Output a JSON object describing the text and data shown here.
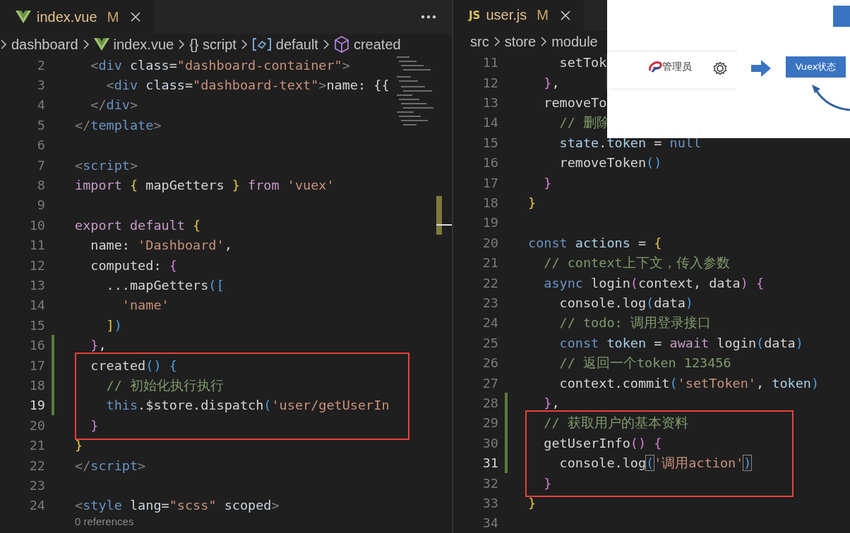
{
  "editors": [
    {
      "tab": {
        "name": "index.vue",
        "status": "M",
        "selected": true
      },
      "breadcrumbs": [
        {
          "label": "dashboard",
          "kind": "folder"
        },
        {
          "label": "index.vue",
          "kind": "file"
        },
        {
          "label": "{} script",
          "kind": "block"
        },
        {
          "label": "default",
          "kind": "namespace"
        },
        {
          "label": "created",
          "kind": "method"
        }
      ],
      "lines": [
        {
          "number": "2",
          "current": false,
          "changed": false,
          "highlighted": false,
          "tokens": [
            {
              "kind": "p",
              "text": "  <"
            },
            {
              "kind": "tag",
              "text": "div"
            },
            {
              "kind": "at",
              "text": " class"
            },
            {
              "kind": "t",
              "text": "="
            },
            {
              "kind": "s",
              "text": "\"dashboard-container\""
            },
            {
              "kind": "p",
              "text": ">"
            }
          ]
        },
        {
          "number": "3",
          "current": false,
          "changed": false,
          "highlighted": false,
          "tokens": [
            {
              "kind": "p",
              "text": "    <"
            },
            {
              "kind": "tag",
              "text": "div"
            },
            {
              "kind": "at",
              "text": " class"
            },
            {
              "kind": "t",
              "text": "="
            },
            {
              "kind": "s",
              "text": "\"dashboard-text\""
            },
            {
              "kind": "p",
              "text": ">"
            },
            {
              "kind": "t",
              "text": "name: {{"
            }
          ]
        },
        {
          "number": "4",
          "current": false,
          "changed": false,
          "highlighted": false,
          "tokens": [
            {
              "kind": "p",
              "text": "  </"
            },
            {
              "kind": "tag",
              "text": "div"
            },
            {
              "kind": "p",
              "text": ">"
            }
          ]
        },
        {
          "number": "5",
          "current": false,
          "changed": false,
          "highlighted": false,
          "tokens": [
            {
              "kind": "p",
              "text": "</"
            },
            {
              "kind": "tag",
              "text": "template"
            },
            {
              "kind": "p",
              "text": ">"
            }
          ]
        },
        {
          "number": "6",
          "current": false,
          "changed": false,
          "highlighted": false
        },
        {
          "number": "7",
          "current": false,
          "changed": false,
          "highlighted": false,
          "tokens": [
            {
              "kind": "p",
              "text": "<"
            },
            {
              "kind": "tag",
              "text": "script"
            },
            {
              "kind": "p",
              "text": ">"
            }
          ]
        },
        {
          "number": "8",
          "current": false,
          "changed": false,
          "highlighted": false,
          "tokens": [
            {
              "kind": "kw",
              "text": "import"
            },
            {
              "kind": "y",
              "text": " {"
            },
            {
              "kind": "t",
              "text": " mapGetters "
            },
            {
              "kind": "y",
              "text": "}"
            },
            {
              "kind": "kw",
              "text": " from"
            },
            {
              "kind": "s",
              "text": " 'vuex'"
            }
          ]
        },
        {
          "number": "9",
          "current": false,
          "changed": false,
          "highlighted": false
        },
        {
          "number": "10",
          "current": false,
          "changed": false,
          "highlighted": false,
          "tokens": [
            {
              "kind": "kw",
              "text": "export default"
            },
            {
              "kind": "y",
              "text": " {"
            }
          ]
        },
        {
          "number": "11",
          "current": false,
          "changed": false,
          "highlighted": false,
          "tokens": [
            {
              "kind": "t",
              "text": "  name: "
            },
            {
              "kind": "s",
              "text": "'Dashboard'"
            },
            {
              "kind": "t",
              "text": ","
            }
          ]
        },
        {
          "number": "12",
          "current": false,
          "changed": false,
          "highlighted": false,
          "tokens": [
            {
              "kind": "t",
              "text": "  computed: "
            },
            {
              "kind": "m",
              "text": "{"
            }
          ]
        },
        {
          "number": "13",
          "current": false,
          "changed": false,
          "highlighted": false,
          "tokens": [
            {
              "kind": "t",
              "text": "    ...mapGetters"
            },
            {
              "kind": "b",
              "text": "(["
            }
          ]
        },
        {
          "number": "14",
          "current": false,
          "changed": false,
          "highlighted": false,
          "tokens": [
            {
              "kind": "s",
              "text": "      'name'"
            }
          ]
        },
        {
          "number": "15",
          "current": false,
          "changed": false,
          "highlighted": false,
          "tokens": [
            {
              "kind": "y",
              "text": "    ]"
            },
            {
              "kind": "b",
              "text": ")"
            }
          ]
        },
        {
          "number": "16",
          "current": false,
          "changed": true,
          "highlighted": false,
          "tokens": [
            {
              "kind": "m",
              "text": "  }"
            },
            {
              "kind": "t",
              "text": ","
            }
          ]
        },
        {
          "number": "17",
          "current": false,
          "changed": true,
          "highlighted": true,
          "tokens": [
            {
              "kind": "t",
              "text": "  created"
            },
            {
              "kind": "b",
              "text": "()"
            },
            {
              "kind": "b",
              "text": " {"
            }
          ]
        },
        {
          "number": "18",
          "current": false,
          "changed": true,
          "highlighted": true,
          "tokens": [
            {
              "kind": "c",
              "text": "    // 初始化执行执行"
            }
          ]
        },
        {
          "number": "19",
          "current": true,
          "changed": true,
          "highlighted": true,
          "tokens": [
            {
              "kind": "kb",
              "text": "    this"
            },
            {
              "kind": "t",
              "text": ".$store.dispatch"
            },
            {
              "kind": "b",
              "text": "("
            },
            {
              "kind": "s",
              "text": "'user/getUserIn"
            }
          ]
        },
        {
          "number": "20",
          "current": false,
          "changed": false,
          "highlighted": true,
          "tokens": [
            {
              "kind": "m",
              "text": "  }"
            }
          ]
        },
        {
          "number": "21",
          "current": false,
          "changed": false,
          "highlighted": false,
          "tokens": [
            {
              "kind": "y",
              "text": "}"
            }
          ]
        },
        {
          "number": "22",
          "current": false,
          "changed": false,
          "highlighted": false,
          "tokens": [
            {
              "kind": "p",
              "text": "</"
            },
            {
              "kind": "tag",
              "text": "script"
            },
            {
              "kind": "p",
              "text": ">"
            }
          ]
        },
        {
          "number": "23",
          "current": false,
          "changed": false,
          "highlighted": false
        },
        {
          "number": "24",
          "current": false,
          "changed": false,
          "highlighted": false,
          "tokens": [
            {
              "kind": "p",
              "text": "<"
            },
            {
              "kind": "tag",
              "text": "style"
            },
            {
              "kind": "at",
              "text": " lang"
            },
            {
              "kind": "t",
              "text": "="
            },
            {
              "kind": "s",
              "text": "\"scss\""
            },
            {
              "kind": "at",
              "text": " scoped"
            },
            {
              "kind": "p",
              "text": ">"
            }
          ]
        }
      ],
      "code_lens": "0 references"
    },
    {
      "tab": {
        "badge": "JS",
        "name": "user.js",
        "status": "M",
        "selected": true
      },
      "breadcrumbs": [
        {
          "label": "src",
          "kind": "folder"
        },
        {
          "label": "store",
          "kind": "folder"
        },
        {
          "label": "module",
          "kind": "folder"
        }
      ],
      "lines": [
        {
          "number": "11",
          "current": false,
          "changed": false,
          "highlighted": false,
          "tokens": [
            {
              "kind": "t",
              "text": "    setTok"
            }
          ]
        },
        {
          "number": "12",
          "current": false,
          "changed": false,
          "highlighted": false,
          "tokens": [
            {
              "kind": "m",
              "text": "  }"
            },
            {
              "kind": "t",
              "text": ","
            }
          ]
        },
        {
          "number": "13",
          "current": false,
          "changed": false,
          "highlighted": false,
          "tokens": [
            {
              "kind": "t",
              "text": "  removeTo"
            }
          ]
        },
        {
          "number": "14",
          "current": false,
          "changed": false,
          "highlighted": false,
          "tokens": [
            {
              "kind": "c",
              "text": "    // 删除"
            }
          ]
        },
        {
          "number": "15",
          "current": false,
          "changed": false,
          "highlighted": false,
          "tokens": [
            {
              "kind": "v",
              "text": "    state"
            },
            {
              "kind": "t",
              "text": "."
            },
            {
              "kind": "v",
              "text": "token"
            },
            {
              "kind": "t",
              "text": " = "
            },
            {
              "kind": "kb",
              "text": "null"
            }
          ]
        },
        {
          "number": "16",
          "current": false,
          "changed": false,
          "highlighted": false,
          "tokens": [
            {
              "kind": "t",
              "text": "    removeToken"
            },
            {
              "kind": "b",
              "text": "()"
            }
          ]
        },
        {
          "number": "17",
          "current": false,
          "changed": false,
          "highlighted": false,
          "tokens": [
            {
              "kind": "m",
              "text": "  }"
            }
          ]
        },
        {
          "number": "18",
          "current": false,
          "changed": false,
          "highlighted": false,
          "tokens": [
            {
              "kind": "y",
              "text": "}"
            }
          ]
        },
        {
          "number": "19",
          "current": false,
          "changed": false,
          "highlighted": false
        },
        {
          "number": "20",
          "current": false,
          "changed": false,
          "highlighted": false,
          "tokens": [
            {
              "kind": "kb",
              "text": "const"
            },
            {
              "kind": "v",
              "text": " actions"
            },
            {
              "kind": "t",
              "text": " = "
            },
            {
              "kind": "y",
              "text": "{"
            }
          ]
        },
        {
          "number": "21",
          "current": false,
          "changed": false,
          "highlighted": false,
          "tokens": [
            {
              "kind": "c",
              "text": "  // context上下文，传入参数"
            }
          ]
        },
        {
          "number": "22",
          "current": false,
          "changed": false,
          "highlighted": false,
          "tokens": [
            {
              "kind": "kb",
              "text": "  async"
            },
            {
              "kind": "t",
              "text": " login"
            },
            {
              "kind": "m",
              "text": "("
            },
            {
              "kind": "t",
              "text": "context, data"
            },
            {
              "kind": "m",
              "text": ")"
            },
            {
              "kind": "m",
              "text": " {"
            }
          ]
        },
        {
          "number": "23",
          "current": false,
          "changed": false,
          "highlighted": false,
          "tokens": [
            {
              "kind": "t",
              "text": "    console.log"
            },
            {
              "kind": "b",
              "text": "("
            },
            {
              "kind": "t",
              "text": "data"
            },
            {
              "kind": "b",
              "text": ")"
            }
          ]
        },
        {
          "number": "24",
          "current": false,
          "changed": false,
          "highlighted": false,
          "tokens": [
            {
              "kind": "c",
              "text": "    // todo: 调用登录接口"
            }
          ]
        },
        {
          "number": "25",
          "current": false,
          "changed": false,
          "highlighted": false,
          "tokens": [
            {
              "kind": "kb",
              "text": "    const"
            },
            {
              "kind": "v",
              "text": " token"
            },
            {
              "kind": "t",
              "text": " = "
            },
            {
              "kind": "kw",
              "text": "await"
            },
            {
              "kind": "t",
              "text": " login"
            },
            {
              "kind": "b",
              "text": "("
            },
            {
              "kind": "t",
              "text": "data"
            },
            {
              "kind": "b",
              "text": ")"
            }
          ]
        },
        {
          "number": "26",
          "current": false,
          "changed": false,
          "highlighted": false,
          "tokens": [
            {
              "kind": "c",
              "text": "    // 返回一个token 123456"
            }
          ]
        },
        {
          "number": "27",
          "current": false,
          "changed": false,
          "highlighted": false,
          "tokens": [
            {
              "kind": "t",
              "text": "    context.commit"
            },
            {
              "kind": "b",
              "text": "("
            },
            {
              "kind": "s",
              "text": "'setToken'"
            },
            {
              "kind": "t",
              "text": ", "
            },
            {
              "kind": "v",
              "text": "token"
            },
            {
              "kind": "b",
              "text": ")"
            }
          ]
        },
        {
          "number": "28",
          "current": false,
          "changed": true,
          "highlighted": false,
          "tokens": [
            {
              "kind": "m",
              "text": "  }"
            },
            {
              "kind": "t",
              "text": ","
            }
          ]
        },
        {
          "number": "29",
          "current": false,
          "changed": true,
          "highlighted": true,
          "tokens": [
            {
              "kind": "c",
              "text": "  // 获取用户的基本资料"
            }
          ]
        },
        {
          "number": "30",
          "current": false,
          "changed": true,
          "highlighted": true,
          "tokens": [
            {
              "kind": "t",
              "text": "  getUserInfo"
            },
            {
              "kind": "m",
              "text": "()"
            },
            {
              "kind": "m",
              "text": " {"
            }
          ]
        },
        {
          "number": "31",
          "current": true,
          "changed": true,
          "highlighted": true,
          "tokens": [
            {
              "kind": "t",
              "text": "    console.log"
            },
            {
              "kind": "bm",
              "text": "("
            },
            {
              "kind": "s",
              "text": "'调用action'"
            },
            {
              "kind": "bm",
              "text": ")"
            }
          ]
        },
        {
          "number": "32",
          "current": false,
          "changed": false,
          "highlighted": true,
          "tokens": [
            {
              "kind": "m",
              "text": "  }"
            }
          ]
        },
        {
          "number": "33",
          "current": false,
          "changed": false,
          "highlighted": false,
          "tokens": [
            {
              "kind": "y",
              "text": "}"
            }
          ]
        },
        {
          "number": "34",
          "current": false,
          "changed": false,
          "highlighted": false
        }
      ]
    }
  ],
  "overlay": {
    "user_label": "管理员",
    "state_box": "Vuex状态"
  }
}
